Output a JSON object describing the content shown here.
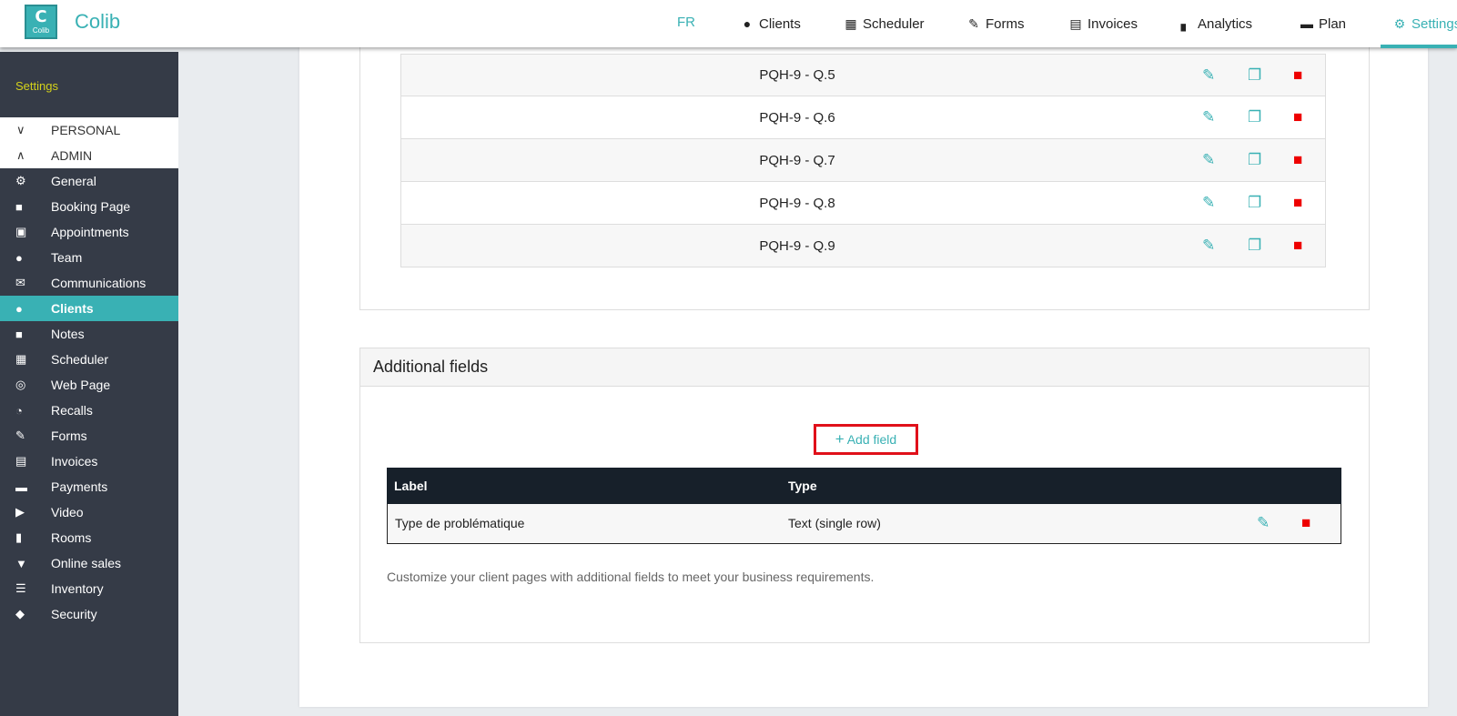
{
  "app": {
    "logo_letter": "C",
    "logo_small": "Colib",
    "name": "Colib"
  },
  "nav": {
    "lang": "FR",
    "items": [
      {
        "label": "Clients",
        "icon": "user-icon"
      },
      {
        "label": "Scheduler",
        "icon": "calendar-icon"
      },
      {
        "label": "Forms",
        "icon": "signature-icon"
      },
      {
        "label": "Invoices",
        "icon": "invoice-icon"
      },
      {
        "label": "Analytics",
        "icon": "chart-icon"
      },
      {
        "label": "Plan",
        "icon": "card-icon"
      },
      {
        "label": "Settings",
        "icon": "gear-icon"
      }
    ]
  },
  "sidebar": {
    "title": "Settings",
    "personal": "PERSONAL",
    "admin": "ADMIN",
    "items": [
      {
        "label": "General",
        "icon": "gear-icon"
      },
      {
        "label": "Booking Page",
        "icon": "clipboard-icon"
      },
      {
        "label": "Appointments",
        "icon": "address-book-icon"
      },
      {
        "label": "Team",
        "icon": "users-icon"
      },
      {
        "label": "Communications",
        "icon": "envelope-icon"
      },
      {
        "label": "Clients",
        "icon": "user-icon"
      },
      {
        "label": "Notes",
        "icon": "note-icon"
      },
      {
        "label": "Scheduler",
        "icon": "calendar-icon"
      },
      {
        "label": "Web Page",
        "icon": "globe-icon"
      },
      {
        "label": "Recalls",
        "icon": "stopwatch-icon"
      },
      {
        "label": "Forms",
        "icon": "signature-icon"
      },
      {
        "label": "Invoices",
        "icon": "invoice-icon"
      },
      {
        "label": "Payments",
        "icon": "credit-card-icon"
      },
      {
        "label": "Video",
        "icon": "video-icon"
      },
      {
        "label": "Rooms",
        "icon": "door-icon"
      },
      {
        "label": "Online sales",
        "icon": "cart-icon"
      },
      {
        "label": "Inventory",
        "icon": "list-icon"
      },
      {
        "label": "Security",
        "icon": "shield-icon"
      }
    ]
  },
  "questions": {
    "rows": [
      "PQH-9 - Q.5",
      "PQH-9 - Q.6",
      "PQH-9 - Q.7",
      "PQH-9 - Q.8",
      "PQH-9 - Q.9"
    ]
  },
  "additional_fields": {
    "title": "Additional fields",
    "add_button": "Add field",
    "headers": {
      "label": "Label",
      "type": "Type"
    },
    "rows": [
      {
        "label": "Type de problématique",
        "type": "Text (single row)"
      }
    ],
    "hint": "Customize your client pages with additional fields to meet your business requirements."
  },
  "colors": {
    "accent": "#39b1b4",
    "sidebar": "#353b47",
    "delete": "#e00000",
    "highlight_border": "#e0101a"
  }
}
